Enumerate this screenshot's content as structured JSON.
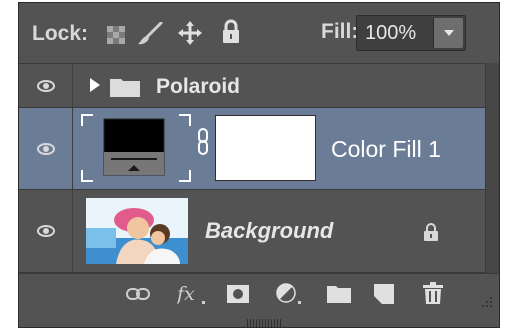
{
  "lock_bar": {
    "lock_label": "Lock:",
    "fill_label": "Fill:",
    "fill_value": "100%",
    "icons": [
      "lock-transparent-pixels-icon",
      "lock-image-pixels-icon",
      "lock-position-icon",
      "lock-all-icon"
    ]
  },
  "layers": [
    {
      "name": "Polaroid",
      "kind": "group",
      "visible": true,
      "expanded": false,
      "selected": false
    },
    {
      "name": "Color Fill 1",
      "kind": "fill",
      "visible": true,
      "selected": true,
      "fill_color": "#000000"
    },
    {
      "name": "Background",
      "kind": "image",
      "visible": true,
      "locked": true,
      "selected": false
    }
  ],
  "bottom_bar": {
    "icons": [
      "link-layers-icon",
      "fx-icon",
      "add-mask-icon",
      "adjustment-layer-icon",
      "new-group-icon",
      "new-layer-icon",
      "trash-icon"
    ]
  },
  "colors": {
    "panel_bg": "#535353",
    "selected_row": "#6a7c96",
    "text": "#e6e6e6"
  }
}
